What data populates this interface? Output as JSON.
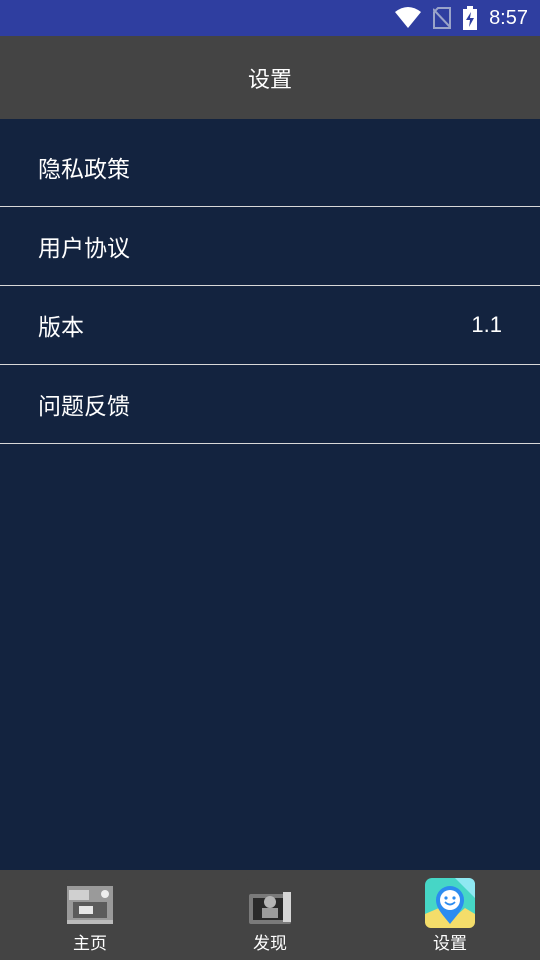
{
  "status_bar": {
    "time": "8:57",
    "icons": [
      "wifi-icon",
      "no-sim-icon",
      "battery-charging-icon"
    ]
  },
  "header": {
    "title": "设置"
  },
  "menu": {
    "items": [
      {
        "label": "隐私政策",
        "value": ""
      },
      {
        "label": "用户协议",
        "value": ""
      },
      {
        "label": "版本",
        "value": "1.1"
      },
      {
        "label": "问题反馈",
        "value": ""
      }
    ]
  },
  "bottom_nav": {
    "items": [
      {
        "label": "主页",
        "icon": "home-photo-icon"
      },
      {
        "label": "发现",
        "icon": "discover-photo-icon"
      },
      {
        "label": "设置",
        "icon": "location-pin-icon"
      }
    ],
    "active_index": 2
  },
  "colors": {
    "status_bar": "#2f3ea0",
    "app_bar": "#444444",
    "background": "#13233f",
    "divider": "#d8d8d8",
    "bottom_nav": "#444444"
  }
}
